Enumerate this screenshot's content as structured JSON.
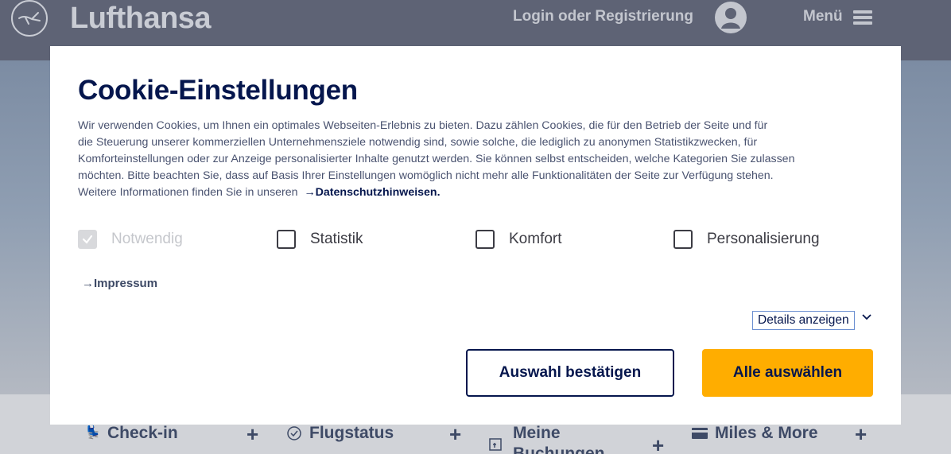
{
  "header": {
    "brand": "Lufthansa",
    "login": "Login oder Registrierung",
    "menu": "Menü"
  },
  "quickbar": {
    "items": [
      {
        "label": "Check-in",
        "icon": "checkin-seat-icon"
      },
      {
        "label": "Flugstatus",
        "icon": "clock-check-icon"
      },
      {
        "label": "Meine Buchungen",
        "icon": "calendar-booking-icon"
      },
      {
        "label": "Miles & More",
        "icon": "card-icon"
      }
    ],
    "expand_symbol": "+"
  },
  "cookie_dialog": {
    "title": "Cookie-Einstellungen",
    "text_lines": [
      "Wir verwenden Cookies, um Ihnen ein optimales Webseiten-Erlebnis zu bieten. Dazu zählen Cookies, die für den Betrieb der Seite und für",
      "die Steuerung unserer kommerziellen Unternehmensziele notwendig sind, sowie solche, die lediglich zu anonymen Statistikzwecken, für",
      "Komforteinstellungen oder zur Anzeige personalisierter Inhalte genutzt werden. Sie können selbst entscheiden, welche Kategorien Sie zulassen",
      "möchten. Bitte beachten Sie, dass auf Basis Ihrer Einstellungen womöglich nicht mehr alle Funktionalitäten der Seite zur Verfügung stehen."
    ],
    "text_last_line": "Weitere Informationen finden Sie in unseren",
    "privacy_link": "Datenschutzhinweisen.",
    "options": [
      {
        "label": "Notwendig",
        "checked": true,
        "disabled": true
      },
      {
        "label": "Statistik",
        "checked": false,
        "disabled": false
      },
      {
        "label": "Komfort",
        "checked": false,
        "disabled": false
      },
      {
        "label": "Personalisierung",
        "checked": false,
        "disabled": false
      }
    ],
    "impressum_link": "Impressum",
    "details_toggle": "Details anzeigen",
    "confirm_button": "Auswahl bestätigen",
    "accept_all_button": "Alle auswählen"
  },
  "colors": {
    "navy": "#05164d",
    "accent_yellow": "#ffad00",
    "header_bg": "#5e6375"
  }
}
